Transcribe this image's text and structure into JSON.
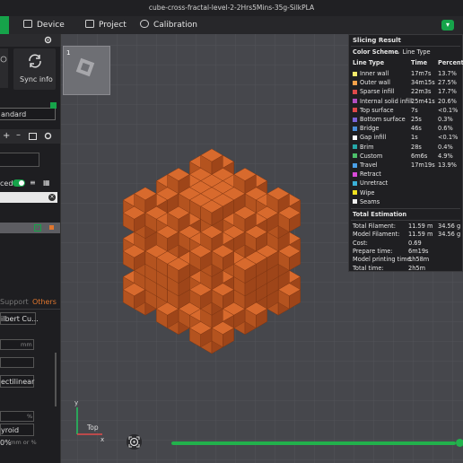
{
  "window": {
    "title": "cube-cross-fractal-level-2-2Hrs5Mins-35g-SilkPLA"
  },
  "tabs": [
    {
      "label": "Device"
    },
    {
      "label": "Project"
    },
    {
      "label": "Calibration"
    }
  ],
  "sidebar": {
    "sync_label": "Sync info",
    "preset": "andard",
    "toggle_label": "ced",
    "support_tab": "Support",
    "others_tab": "Others",
    "field_ilbert": "ilbert Cu...",
    "unit_mm": "mm",
    "field_rectilinear": "ectilinear",
    "percent": "%",
    "field_gyroid": "yroid",
    "field_bottom": "0%",
    "bottom_unit": "mm or %"
  },
  "plate": {
    "number": "1"
  },
  "viewport": {
    "axis_y": "y",
    "axis_x": "x",
    "view_label": "Top"
  },
  "slicing": {
    "title": "Slicing Result",
    "color_scheme_label": "Color Scheme",
    "color_scheme_value": "Line Type",
    "headers": [
      "Line Type",
      "Time",
      "Percent"
    ],
    "rows": [
      {
        "name": "Inner wall",
        "time": "17m7s",
        "pct": "13.7%",
        "color": "#f4ea6b"
      },
      {
        "name": "Outer wall",
        "time": "34m15s",
        "pct": "27.5%",
        "color": "#f5a14a"
      },
      {
        "name": "Sparse infill",
        "time": "22m3s",
        "pct": "17.7%",
        "color": "#de4a4a"
      },
      {
        "name": "Internal solid infill",
        "time": "25m41s",
        "pct": "20.6%",
        "color": "#b24fc1"
      },
      {
        "name": "Top surface",
        "time": "7s",
        "pct": "<0.1%",
        "color": "#e04848"
      },
      {
        "name": "Bottom surface",
        "time": "25s",
        "pct": "0.3%",
        "color": "#7a64d8"
      },
      {
        "name": "Bridge",
        "time": "46s",
        "pct": "0.6%",
        "color": "#4a8fd8"
      },
      {
        "name": "Gap infill",
        "time": "1s",
        "pct": "<0.1%",
        "color": "#ffffff"
      },
      {
        "name": "Brim",
        "time": "28s",
        "pct": "0.4%",
        "color": "#25a8a8"
      },
      {
        "name": "Custom",
        "time": "6m6s",
        "pct": "4.9%",
        "color": "#4cc06a"
      },
      {
        "name": "Travel",
        "time": "17m19s",
        "pct": "13.9%",
        "color": "#4aa0e8"
      },
      {
        "name": "Retract",
        "time": "",
        "pct": "",
        "color": "#d84ad8"
      },
      {
        "name": "Unretract",
        "time": "",
        "pct": "",
        "color": "#3ab0d8"
      },
      {
        "name": "Wipe",
        "time": "",
        "pct": "",
        "color": "#f0e020"
      },
      {
        "name": "Seams",
        "time": "",
        "pct": "",
        "color": "#eeeeee"
      }
    ],
    "total_title": "Total Estimation",
    "totals": [
      {
        "label": "Total Filament:",
        "v1": "11.59 m",
        "v2": "34.56 g"
      },
      {
        "label": "Model Filament:",
        "v1": "11.59 m",
        "v2": "34.56 g"
      },
      {
        "label": "Cost:",
        "v1": "0.69",
        "v2": ""
      },
      {
        "label": "Prepare time:",
        "v1": "6m19s",
        "v2": ""
      },
      {
        "label": "Model printing time:",
        "v1": "1h58m",
        "v2": ""
      },
      {
        "label": "Total time:",
        "v1": "2h5m",
        "v2": ""
      }
    ]
  },
  "layer_slider": {
    "progress": 1.0
  }
}
